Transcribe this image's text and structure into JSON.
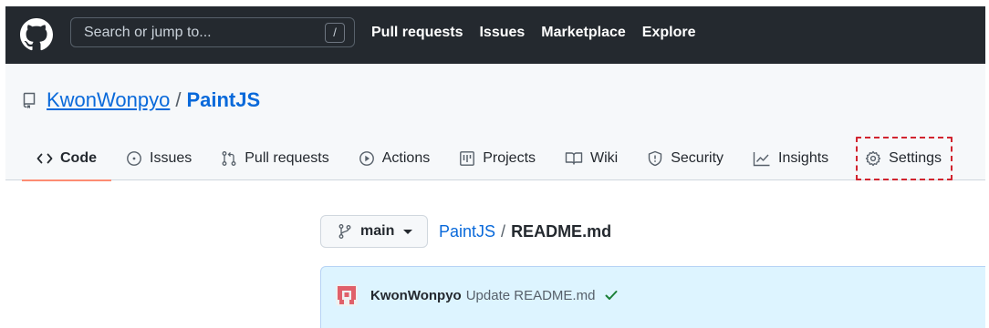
{
  "header": {
    "search_placeholder": "Search or jump to...",
    "search_key": "/",
    "nav": [
      "Pull requests",
      "Issues",
      "Marketplace",
      "Explore"
    ]
  },
  "repo": {
    "owner": "KwonWonpyo",
    "separator": "/",
    "name": "PaintJS"
  },
  "tabs": [
    {
      "label": "Code",
      "icon": "code-icon",
      "selected": true
    },
    {
      "label": "Issues",
      "icon": "issue-opened-icon"
    },
    {
      "label": "Pull requests",
      "icon": "git-pull-request-icon"
    },
    {
      "label": "Actions",
      "icon": "play-icon"
    },
    {
      "label": "Projects",
      "icon": "project-icon"
    },
    {
      "label": "Wiki",
      "icon": "book-icon"
    },
    {
      "label": "Security",
      "icon": "shield-icon"
    },
    {
      "label": "Insights",
      "icon": "graph-icon"
    },
    {
      "label": "Settings",
      "icon": "gear-icon",
      "highlighted": true
    }
  ],
  "file_nav": {
    "branch": "main",
    "repo_link": "PaintJS",
    "separator": "/",
    "file": "README.md"
  },
  "commit": {
    "author": "KwonWonpyo",
    "message": "Update README.md",
    "status": "check-icon"
  },
  "colors": {
    "header_bg": "#24292f",
    "link": "#0969da",
    "tab_underline": "#fd8c73",
    "highlight_outline": "#d1242f",
    "commit_bg": "#ddf4ff",
    "check": "#1a7f37"
  }
}
